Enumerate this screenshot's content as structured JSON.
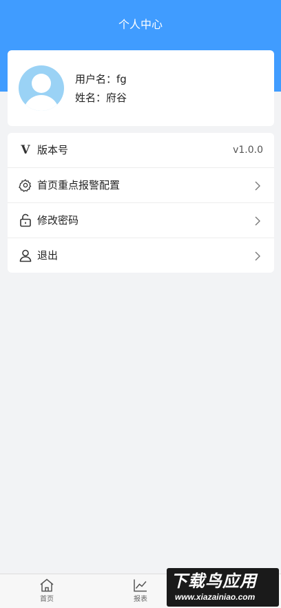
{
  "header": {
    "title": "个人中心"
  },
  "profile": {
    "username_line": "用户名：fg",
    "name_line": "姓名：府谷"
  },
  "menu": {
    "items": [
      {
        "label": "版本号",
        "icon": "v-icon",
        "value": "v1.0.0"
      },
      {
        "label": "首页重点报警配置",
        "icon": "gear-icon"
      },
      {
        "label": "修改密码",
        "icon": "lock-icon"
      },
      {
        "label": "退出",
        "icon": "user-icon"
      }
    ]
  },
  "tabbar": {
    "tabs": [
      {
        "label": "首页",
        "icon": "home-icon"
      },
      {
        "label": "报表",
        "icon": "chart-icon"
      }
    ]
  },
  "watermark": {
    "main": "下载鸟应用",
    "sub": "www.xiazainiao.com"
  },
  "colors": {
    "accent": "#409cff",
    "avatar": "#9ad2f5",
    "background": "#f2f3f5"
  }
}
